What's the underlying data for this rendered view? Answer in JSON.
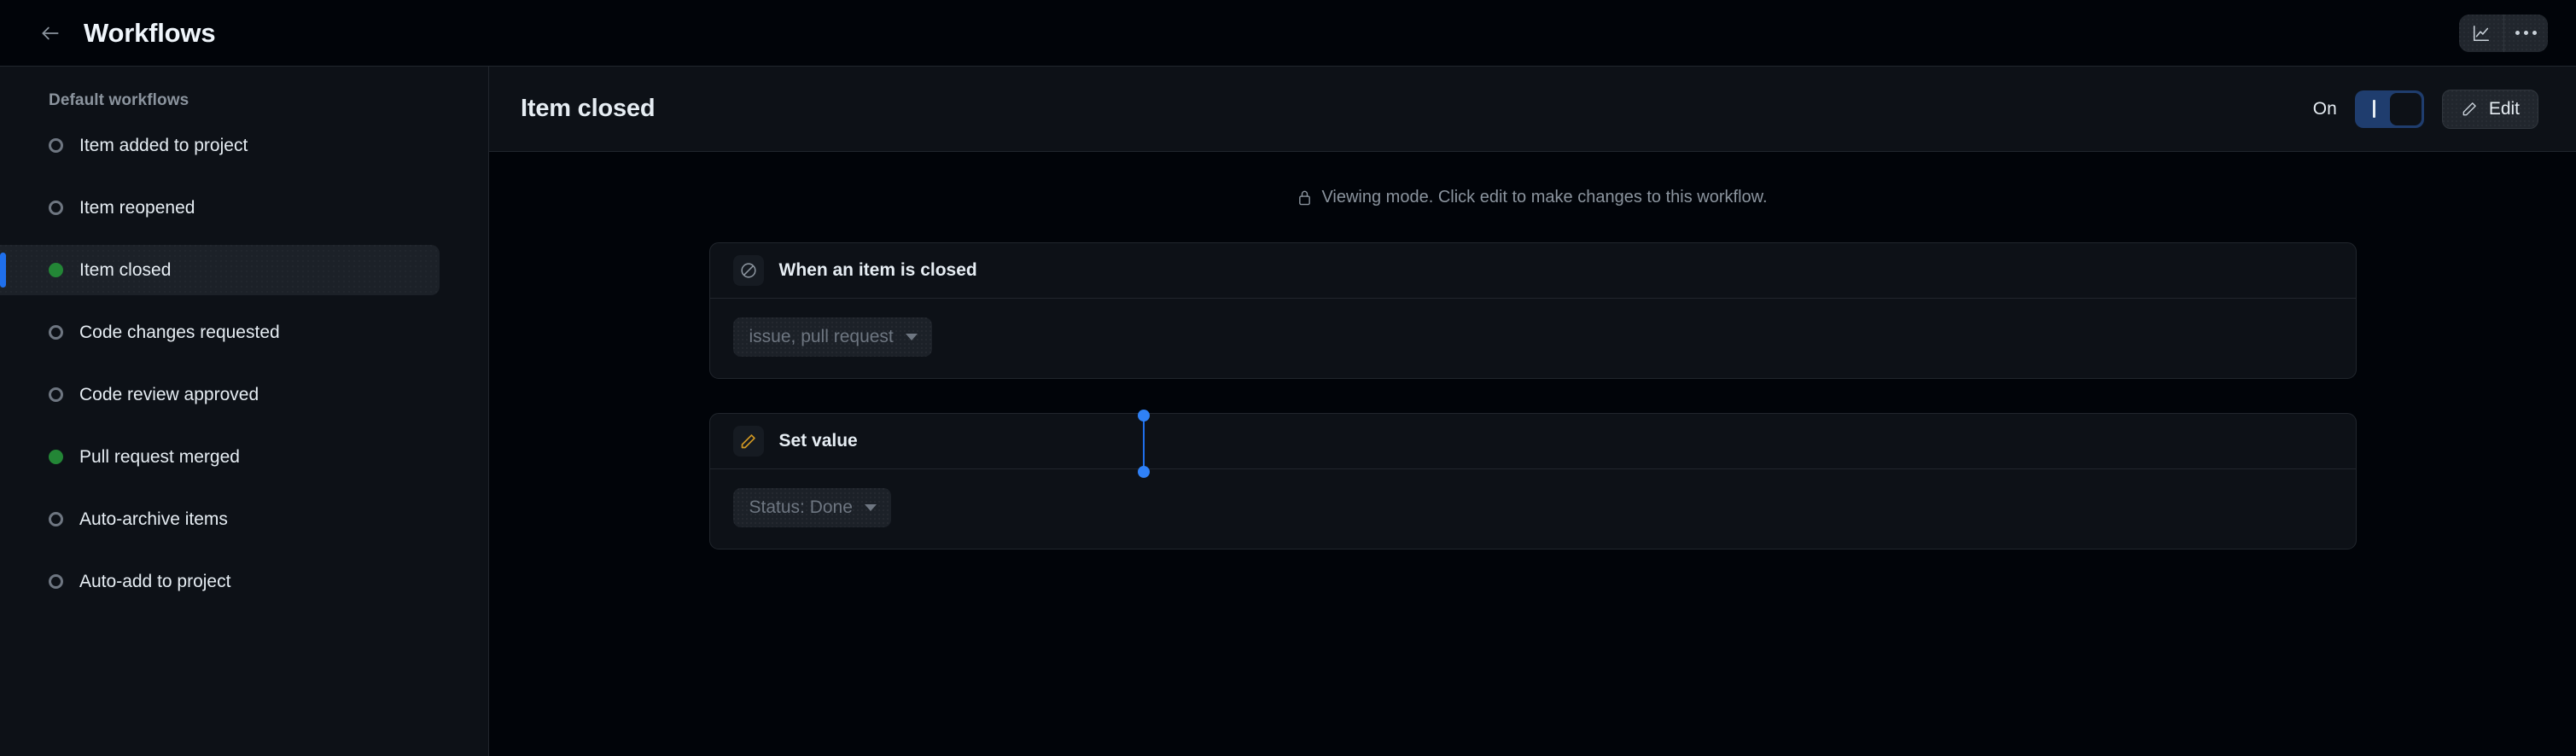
{
  "topbar": {
    "back_icon": "arrow-left-icon",
    "title": "Workflows",
    "insights_icon": "line-chart-icon",
    "more_icon": "kebab-horizontal-icon"
  },
  "sidebar": {
    "heading": "Default workflows",
    "items": [
      {
        "label": "Item added to project",
        "enabled": false,
        "active": false
      },
      {
        "label": "Item reopened",
        "enabled": false,
        "active": false
      },
      {
        "label": "Item closed",
        "enabled": true,
        "active": true
      },
      {
        "label": "Code changes requested",
        "enabled": false,
        "active": false
      },
      {
        "label": "Code review approved",
        "enabled": false,
        "active": false
      },
      {
        "label": "Pull request merged",
        "enabled": true,
        "active": false
      },
      {
        "label": "Auto-archive items",
        "enabled": false,
        "active": false
      },
      {
        "label": "Auto-add to project",
        "enabled": false,
        "active": false
      }
    ]
  },
  "main": {
    "title": "Item closed",
    "toggle_label": "On",
    "toggle_state": "on",
    "edit_label": "Edit",
    "edit_icon": "pencil-icon",
    "viewing_note": "Viewing mode. Click edit to make changes to this workflow.",
    "viewing_note_icon": "lock-icon"
  },
  "flow": {
    "trigger": {
      "icon": "skip-icon",
      "title": "When an item is closed",
      "value": "issue, pull request"
    },
    "action": {
      "icon": "pencil-icon",
      "title": "Set value",
      "value": "Status: Done"
    }
  },
  "colors": {
    "accent": "#1f6feb",
    "connector": "#2f81f7",
    "enabled_dot": "#238636",
    "disabled_dot": "#6e7681",
    "action_icon": "#d29922",
    "canvas_bg": "#010409",
    "panel_bg": "#0d1117",
    "border": "#21262d"
  }
}
